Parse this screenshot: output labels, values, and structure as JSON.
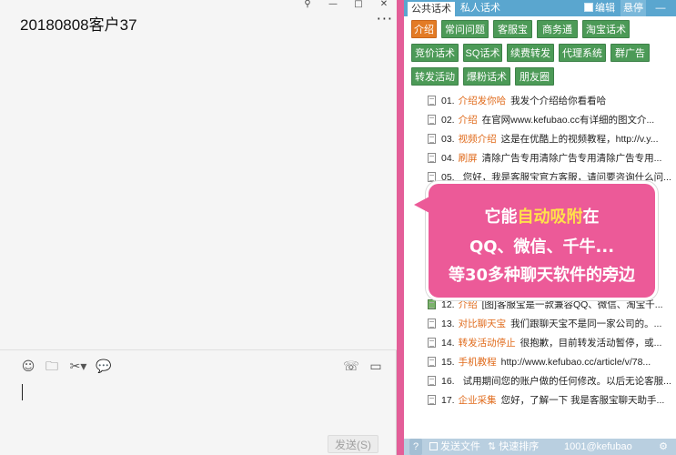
{
  "chat": {
    "title": "20180808客户37",
    "window_controls": [
      "⚲",
      "—",
      "□",
      "✕"
    ],
    "more_label": "···",
    "toolbar": {
      "emoji": "☺",
      "folder": "🗀",
      "scissors": "✂▾",
      "chat_bubble": "💬",
      "phone": "☏",
      "video": "▭"
    },
    "send_label": "发送(S)"
  },
  "panel": {
    "tabs": [
      "公共话术",
      "私人话术"
    ],
    "edit_label": "编辑",
    "hover_label": "悬停",
    "minimize_label": "—",
    "categories": [
      "介绍",
      "常问问题",
      "客服宝",
      "商务通",
      "淘宝话术",
      "竞价话术",
      "SQ话术",
      "续费转发",
      "代理系统",
      "群广告",
      "转发活动",
      "爆粉话术",
      "朋友圈"
    ],
    "items": [
      {
        "num": "01.",
        "category": "介绍发你哈",
        "text": "我发个介绍给你看看哈",
        "icon": "doc"
      },
      {
        "num": "02.",
        "category": "介绍",
        "text": "在官网www.kefubao.cc有详细的图文介...",
        "icon": "doc"
      },
      {
        "num": "03.",
        "category": "视频介绍",
        "text": "这是在优酷上的视频教程，http://v.y...",
        "icon": "doc"
      },
      {
        "num": "04.",
        "category": "刷屏",
        "text": "清除广告专用清除广告专用清除广告专用...",
        "icon": "doc"
      },
      {
        "num": "05.",
        "category": "",
        "text": "您好，我是客服宝官方客服，请问要咨询什么问...",
        "icon": "doc"
      },
      {
        "num": "12.",
        "category": "介绍",
        "text": "[图]客服宝是一款兼容QQ、微信、淘宝千...",
        "icon": "img"
      },
      {
        "num": "13.",
        "category": "对比聊天宝",
        "text": "我们跟聊天宝不是同一家公司的。...",
        "icon": "doc"
      },
      {
        "num": "14.",
        "category": "转发活动停止",
        "text": "很抱歉，目前转发活动暂停，或...",
        "icon": "doc"
      },
      {
        "num": "15.",
        "category": "手机教程",
        "text": "http://www.kefubao.cc/article/v/78...",
        "icon": "doc"
      },
      {
        "num": "16.",
        "category": "",
        "text": "试用期间您的账户做的任何修改。以后无论客服...",
        "icon": "doc"
      },
      {
        "num": "17.",
        "category": "企业采集",
        "text": "您好，了解一下 我是客服宝聊天助手...",
        "icon": "doc"
      }
    ],
    "bottom": {
      "help": "?",
      "send_file": "发送文件",
      "quick_sort": "快速排序",
      "status": "1001@kefubao",
      "settings": "⚙"
    }
  },
  "callout": {
    "line1_pre": "它能",
    "line1_highlight": "自动吸附",
    "line1_post": "在",
    "line2": "QQ、微信、千牛...",
    "line3": "等30多种聊天软件的旁边"
  }
}
